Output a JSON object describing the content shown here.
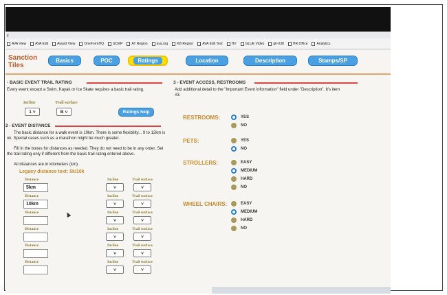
{
  "browser": {
    "top_label": "F",
    "bookmarks": [
      "AVA View",
      "AVA Edit",
      "Award View",
      "OneFormHQ",
      "SCMP",
      "AT Region",
      "ava.org",
      "KB Region",
      "AVA Edit Text",
      "HV",
      "GLUE Video",
      "gh-038",
      "HR Office",
      "Analytics"
    ]
  },
  "nav": {
    "brand_line1": "Sanction",
    "brand_line2": "Tiles",
    "tabs": [
      "Basics",
      "POC",
      "Ratings",
      "Location",
      "Description",
      "Stamps/SP"
    ],
    "active_tab": "Ratings"
  },
  "section1": {
    "title": "- BASIC EVENT TRAIL RATING",
    "desc": "Every event except a Swim, Kayak or Ice Skate requires a basic trail rating.",
    "incline_label": "Incline",
    "trail_label": "Trail surface",
    "incline_value": "1",
    "trail_value": "B",
    "help_button": "Ratings help"
  },
  "section2": {
    "title": "2 - EVENT DISTANCE",
    "p1": "The basic distance for a walk event is 10km. There is some flexibility... 9 to 12km is ok. Special cases such as a marathon might be much greater.",
    "p2": "Fill in the boxes for distances as needed. They do not need to be in any order. Set the trail rating only if different from the basic trail rating entered above.",
    "p3": "All distances are in kilometers (km).",
    "legacy": "Legacy distance text: 5k/10k",
    "distance_label": "Distance",
    "incline_label": "Incline",
    "trail_label": "Trail surface",
    "rows": [
      {
        "distance": "5km"
      },
      {
        "distance": "10km"
      },
      {
        "distance": ""
      },
      {
        "distance": ""
      },
      {
        "distance": ""
      },
      {
        "distance": ""
      }
    ]
  },
  "section3": {
    "title": "3 - EVENT ACCESS, RESTROOMS",
    "desc": "Add additional detail to the \"Important Event Information\" field under \"Description\". It's item #3.",
    "questions": [
      {
        "label": "RESTROOMS:",
        "options": [
          "YES",
          "NO"
        ],
        "selected": "YES"
      },
      {
        "label": "PETS:",
        "options": [
          "YES",
          "NO"
        ],
        "selected": "NO"
      },
      {
        "label": "STROLLERS:",
        "options": [
          "EASY",
          "MEDIUM",
          "HARD",
          "NO"
        ],
        "selected": "MEDIUM"
      },
      {
        "label": "WHEEL CHAIRS:",
        "options": [
          "EASY",
          "MEDIUM",
          "HARD",
          "NO"
        ],
        "selected": "MEDIUM"
      }
    ]
  },
  "colors": {
    "tab_blue": "#4aa0e0",
    "active_highlight": "#ffe100",
    "accent_orange": "#c98a2e",
    "section_rule": "#e04040",
    "radio_selected": "#1f7fd8"
  }
}
